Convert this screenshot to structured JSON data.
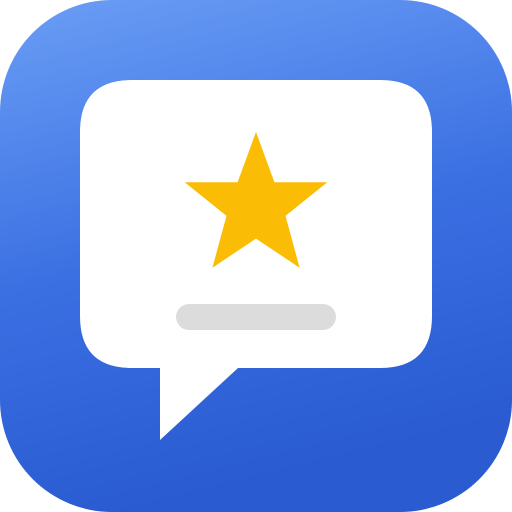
{
  "app_icon": {
    "icon_name": "review-chat-icon",
    "background_gradient": [
      "#6b9ef5",
      "#3a6fe2",
      "#2a5bd1"
    ],
    "bubble_color": "#ffffff",
    "star": {
      "icon_name": "star-icon",
      "color": "#fbbc05"
    },
    "text_line": {
      "icon_name": "placeholder-line",
      "color": "#dcdcdc"
    }
  }
}
